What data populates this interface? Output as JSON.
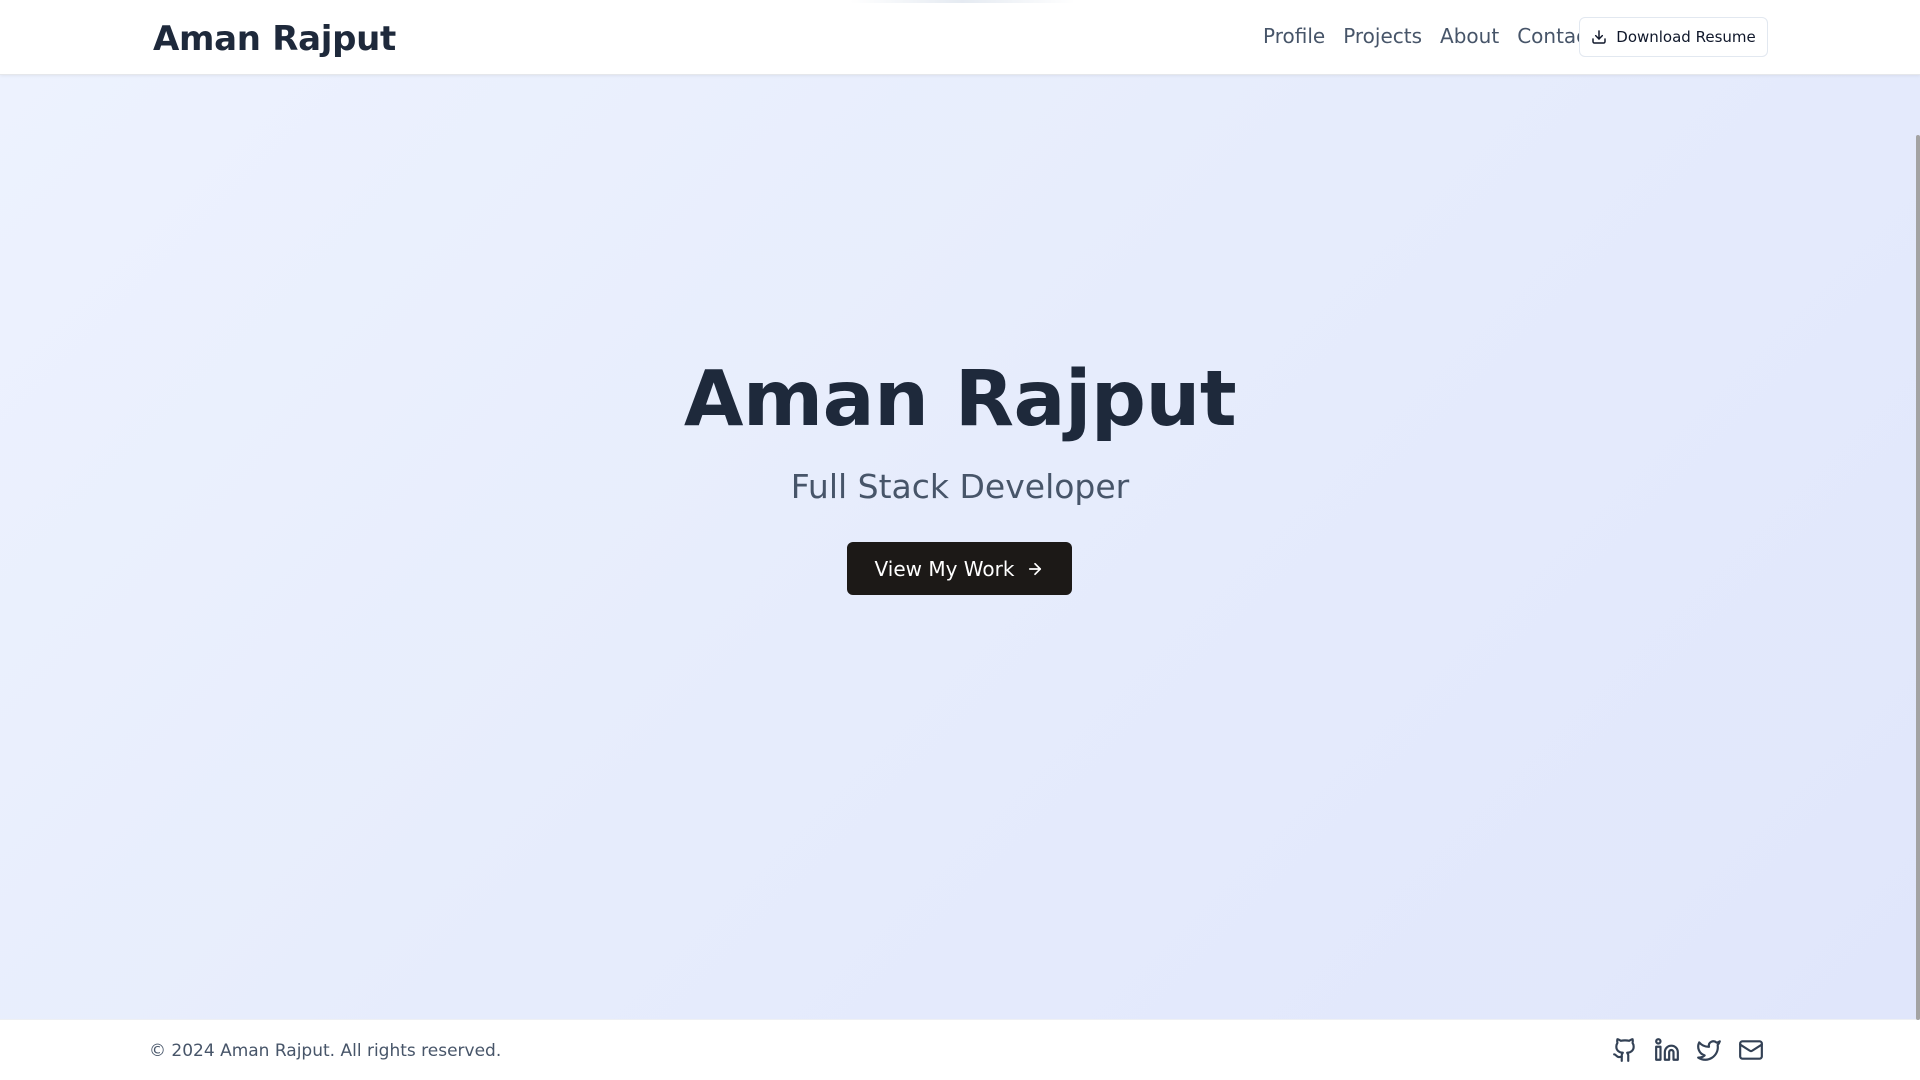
{
  "header": {
    "logo": "Aman Rajput",
    "nav": [
      "Profile",
      "Projects",
      "About",
      "Contact"
    ],
    "resume_button": "Download Resume",
    "resume_icon": "download-icon"
  },
  "hero": {
    "title": "Aman Rajput",
    "subtitle": "Full Stack Developer",
    "cta_button": "View My Work",
    "cta_icon": "arrow-right-icon"
  },
  "footer": {
    "copyright": "© 2024 Aman Rajput. All rights reserved.",
    "social_icons": [
      "github-icon",
      "linkedin-icon",
      "twitter-icon",
      "mail-icon"
    ]
  },
  "colors": {
    "text_dark": "#1e293b",
    "text_muted": "#475569",
    "button_dark": "#1c1917",
    "hero_bg_start": "#edf2fe",
    "hero_bg_end": "#e0e6fb"
  }
}
